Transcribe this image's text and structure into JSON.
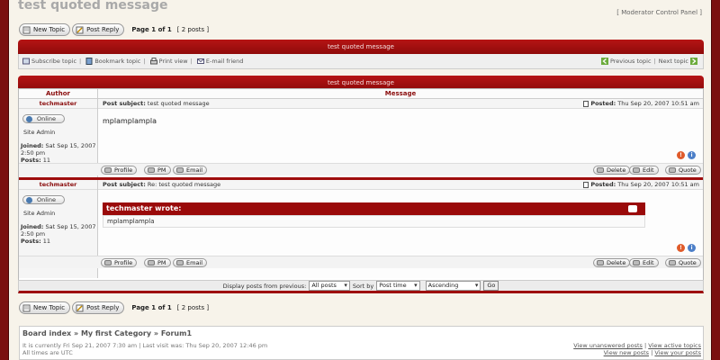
{
  "page": {
    "title": "test quoted message",
    "mod_cp": "Moderator Control Panel"
  },
  "toolbar": {
    "new_topic": "New Topic",
    "post_reply": "Post Reply",
    "page_text": "Page",
    "page_current": "1",
    "page_of": "of",
    "page_total": "1",
    "posts_count": "[ 2 posts ]"
  },
  "topic_bar": {
    "title": "test quoted message"
  },
  "actions": {
    "subscribe": "Subscribe topic",
    "bookmark": "Bookmark topic",
    "print": "Print view",
    "email": "E-mail friend",
    "previous": "Previous topic",
    "next": "Next topic"
  },
  "posts_bar": {
    "title": "test quoted message"
  },
  "columns": {
    "author": "Author",
    "message": "Message"
  },
  "posts": [
    {
      "author": "techmaster",
      "online": "Online",
      "rank": "Site Admin",
      "joined_label": "Joined:",
      "joined": "Sat Sep 15, 2007 2:50 pm",
      "posts_label": "Posts:",
      "posts": "11",
      "subject_label": "Post subject:",
      "subject": "test quoted message",
      "posted_label": "Posted:",
      "posted": "Thu Sep 20, 2007 10:51 am",
      "content": "mplamplampla"
    },
    {
      "author": "techmaster",
      "online": "Online",
      "rank": "Site Admin",
      "joined_label": "Joined:",
      "joined": "Sat Sep 15, 2007 2:50 pm",
      "posts_label": "Posts:",
      "posts": "11",
      "subject_label": "Post subject:",
      "subject": "Re: test quoted message",
      "posted_label": "Posted:",
      "posted": "Thu Sep 20, 2007 10:51 am",
      "quote_header": "techmaster wrote:",
      "quote_body": "mplamplampla"
    }
  ],
  "post_buttons": {
    "profile": "Profile",
    "pm": "PM",
    "email": "Email",
    "delete": "Delete",
    "edit": "Edit",
    "quote": "Quote"
  },
  "display": {
    "label": "Display posts from previous:",
    "posts_value": "All posts",
    "sort_label": "Sort by",
    "sort_value": "Post time",
    "order_value": "Ascending",
    "go": "Go"
  },
  "breadcrumb": {
    "board_index": "Board index",
    "sep": "»",
    "category": "My first Category",
    "forum": "Forum1"
  },
  "status": {
    "line1": "It is currently Fri Sep 21, 2007 7:30 am | Last visit was: Thu Sep 20, 2007 12:46 pm",
    "line2": "All times are UTC"
  },
  "footer_links": {
    "unanswered": "View unanswered posts",
    "active": "View active topics",
    "new_posts": "View new posts",
    "your_posts": "View your posts",
    "sep": "|"
  }
}
